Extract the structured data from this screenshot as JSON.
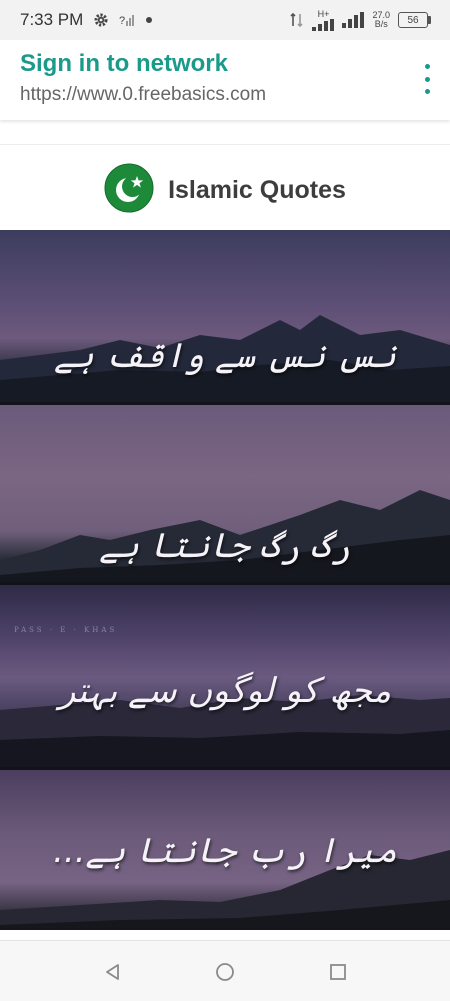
{
  "status_bar": {
    "time": "7:33 PM",
    "icons": [
      "settings-gear-icon",
      "wifi-unknown-icon",
      "notification-dot-icon",
      "data-arrows-icon",
      "signal-hplus-icon",
      "signal-bars-icon"
    ],
    "hplus_label": "H+",
    "speed_value": "27.0",
    "speed_unit": "B/s",
    "battery": "56"
  },
  "browser": {
    "title": "Sign in to network",
    "url": "https://www.0.freebasics.com",
    "accent_color": "#1a9a89"
  },
  "page": {
    "brand_title": "Islamic Quotes",
    "flag_colors": {
      "green": "#1d8a3a",
      "white": "#ffffff"
    }
  },
  "poster": {
    "lines": [
      "نس نس سے واقف ہے",
      "رگ رگ جانتا ہے",
      "مجھ کو لوگوں سے بہتر",
      "میرا رب جانتا ہے..."
    ],
    "watermark": "PASS · E · KHAS"
  },
  "nav_bar": {
    "buttons": [
      "back",
      "home",
      "recents"
    ]
  }
}
